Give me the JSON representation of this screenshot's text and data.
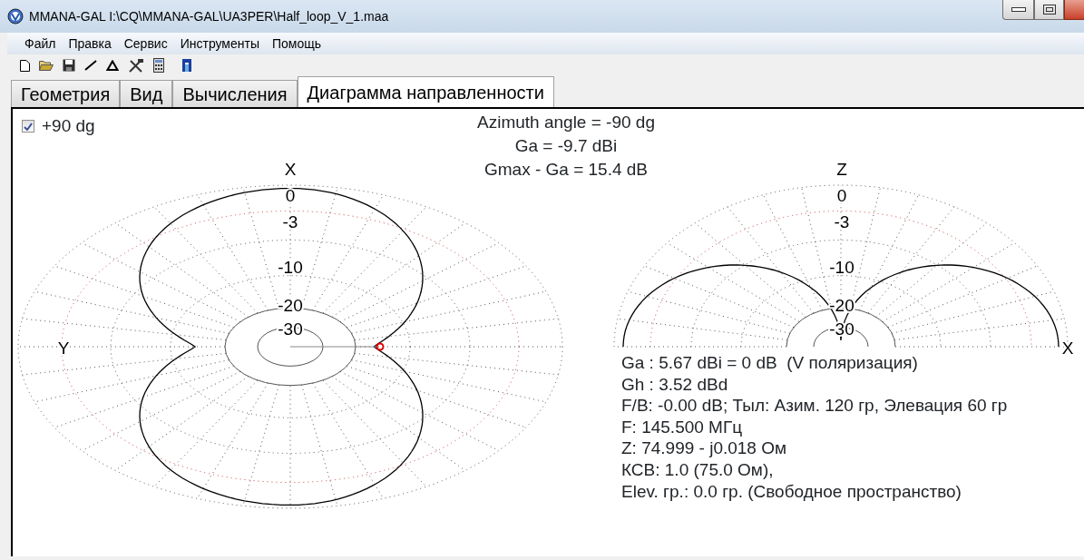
{
  "window": {
    "title": "MMANA-GAL I:\\CQ\\MMANA-GAL\\UA3PER\\Half_loop_V_1.maa"
  },
  "menu": [
    "Файл",
    "Правка",
    "Сервис",
    "Инструменты",
    "Помощь"
  ],
  "tabs": [
    {
      "label": "Геометрия",
      "selected": false
    },
    {
      "label": "Вид",
      "selected": false
    },
    {
      "label": "Вычисления",
      "selected": false
    },
    {
      "label": "Диаграмма направленности",
      "selected": true
    }
  ],
  "checkbox": {
    "label": "+90 dg",
    "checked": true
  },
  "header_lines": [
    "Azimuth angle = -90 dg",
    "Ga = -9.7 dBi",
    "Gmax - Ga = 15.4 dB"
  ],
  "horizontal_plot": {
    "axis_top": "X",
    "axis_side": "Y",
    "ring_labels": [
      "0",
      "-3",
      "-10",
      "-20",
      "-30"
    ]
  },
  "vertical_plot": {
    "axis_top": "Z",
    "axis_side": "X",
    "ring_labels": [
      "0",
      "-3",
      "-10",
      "-20",
      "-30"
    ]
  },
  "results": [
    "Ga : 5.67 dBi = 0 dB  (V поляризация)",
    "Gh : 3.52 dBd",
    "F/B: -0.00 dB; Тыл: Азим. 120 гр, Элевация 60 гр",
    "F: 145.500 МГц",
    "Z: 74.999 - j0.018 Ом",
    "КСВ: 1.0 (75.0 Ом),",
    "Elev. гр.: 0.0 гр. (Свободное пространство)"
  ]
}
